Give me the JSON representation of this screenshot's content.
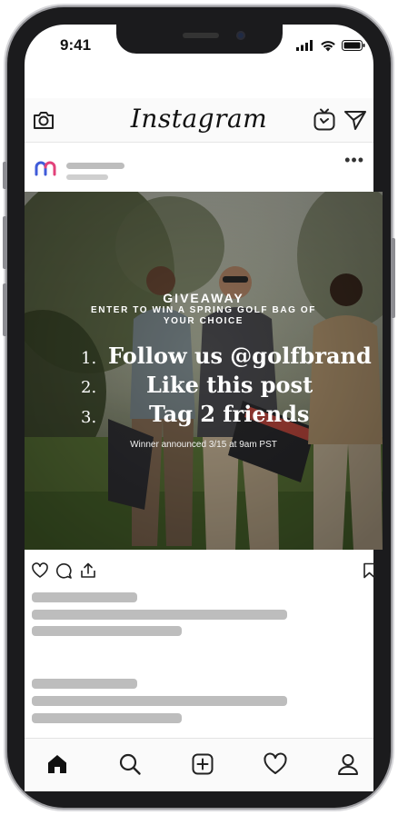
{
  "status_bar": {
    "time": "9:41",
    "icons": [
      "signal-icon",
      "wifi-icon",
      "battery-icon"
    ]
  },
  "header": {
    "app_name": "Instagram",
    "left_icon": "camera-icon",
    "right_icons": [
      "igtv-icon",
      "direct-message-icon"
    ]
  },
  "post": {
    "more_label": "•••",
    "image": {
      "title": "GIVEAWAY",
      "subtitle": "ENTER TO WIN A SPRING GOLF BAG OF YOUR CHOICE",
      "steps": [
        {
          "num": "1.",
          "text": "Follow us @golfbrand"
        },
        {
          "num": "2.",
          "text": "Like this post"
        },
        {
          "num": "3.",
          "text": "Tag 2 friends"
        }
      ],
      "footer": "Winner announced 3/15 at 9am PST"
    },
    "actions": [
      "like-icon",
      "comment-icon",
      "share-icon",
      "bookmark-icon"
    ]
  },
  "bottom_nav": [
    "home-icon",
    "search-icon",
    "new-post-icon",
    "activity-icon",
    "profile-icon"
  ],
  "colors": {
    "accent_blue": "#3f5bd9",
    "accent_pink": "#e2427a",
    "skeleton": "#bdbdbd"
  }
}
